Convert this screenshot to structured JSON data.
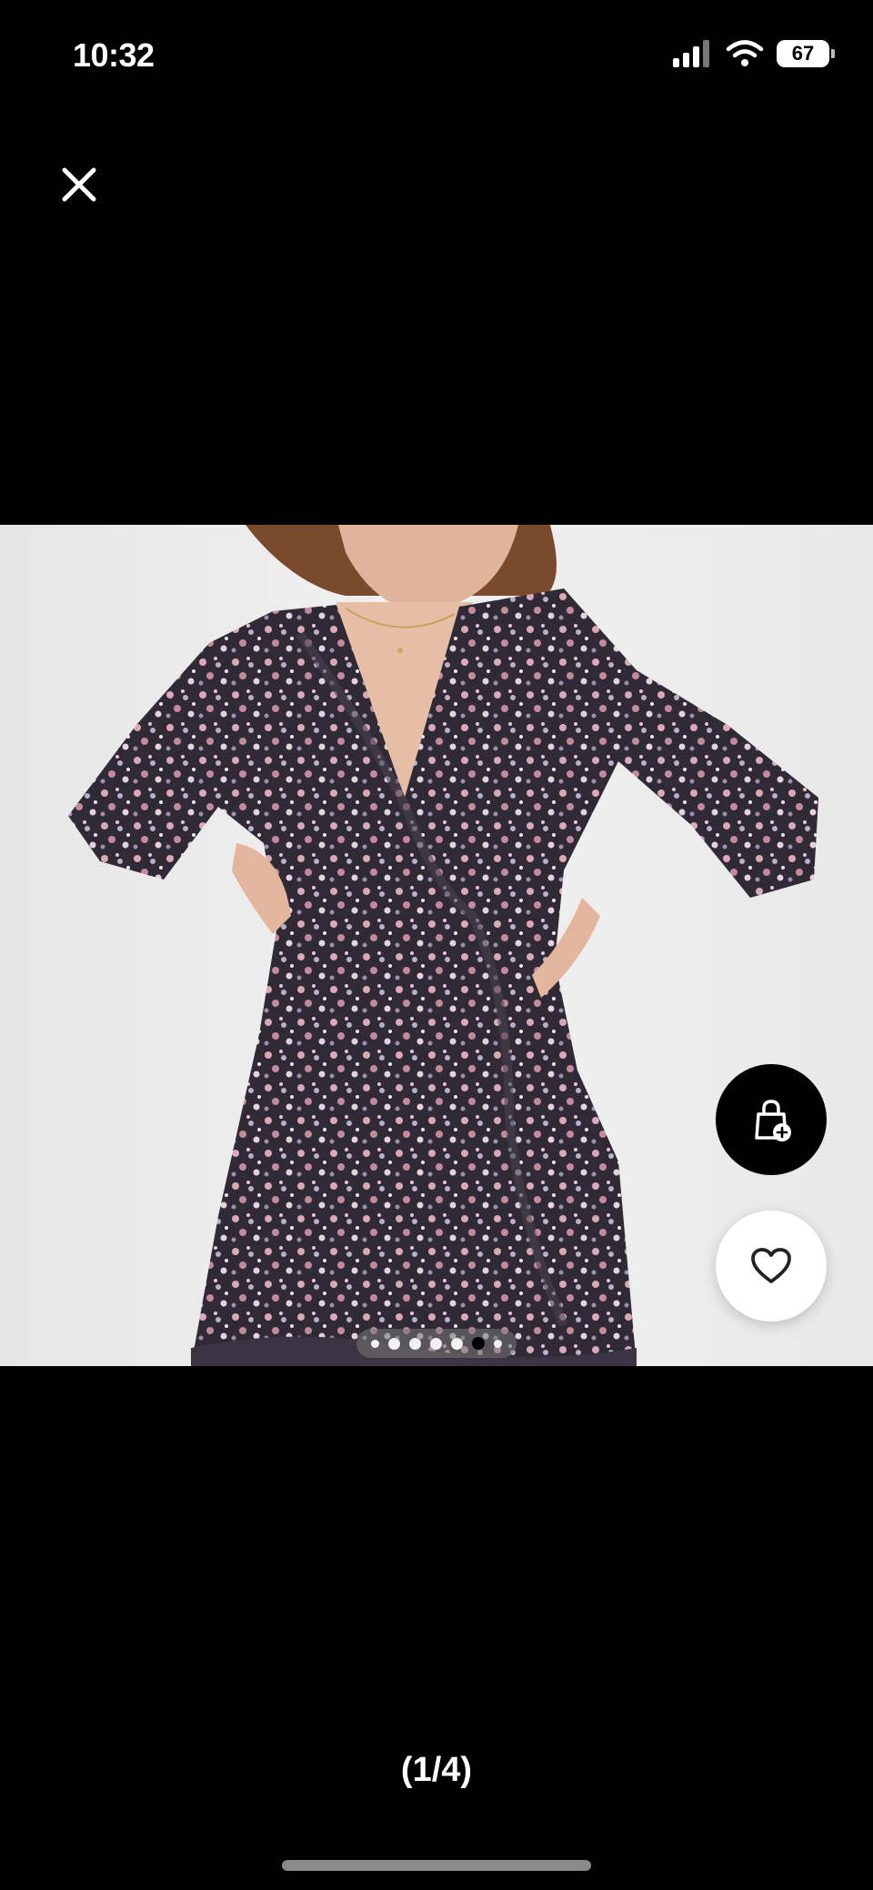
{
  "status_bar": {
    "time": "10:32",
    "battery": "67"
  },
  "viewer": {
    "counter": "(1/4)",
    "pager_dots": 7,
    "active_dot": 5
  },
  "icons": {
    "close": "close-icon",
    "bag": "shopping-bag-add-icon",
    "favorite": "heart-icon"
  },
  "colors": {
    "background": "#000000",
    "image_bg": "#ececec",
    "dress_base": "#3a3440",
    "dress_pink": "#c99aa8"
  }
}
